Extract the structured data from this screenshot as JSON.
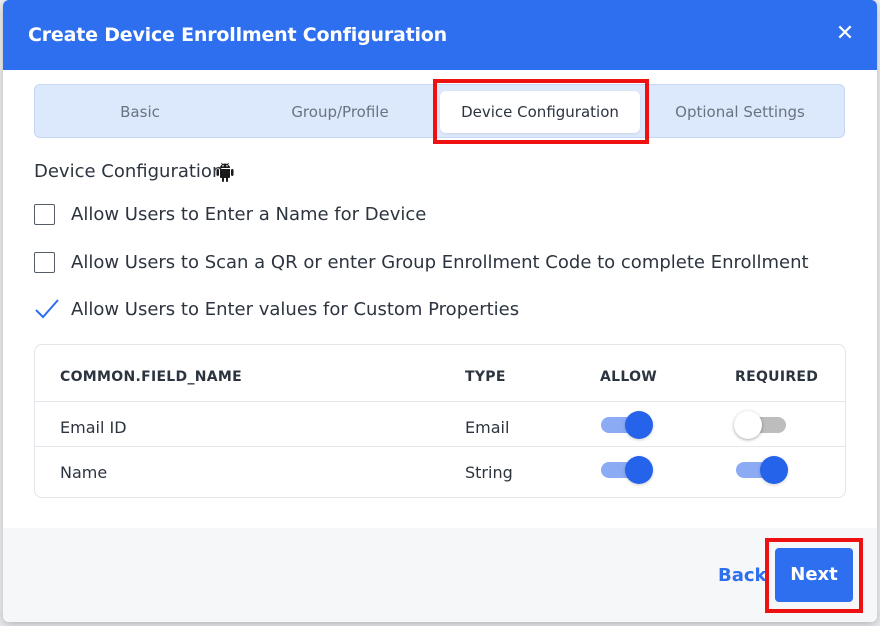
{
  "dialog": {
    "title": "Create Device Enrollment Configuration",
    "close_label": "✕"
  },
  "tabs": [
    {
      "label": "Basic",
      "active": false
    },
    {
      "label": "Group/Profile",
      "active": false
    },
    {
      "label": "Device Configuration",
      "active": true
    },
    {
      "label": "Optional Settings",
      "active": false
    }
  ],
  "section": {
    "title": "Device Configuration",
    "icon": "android-icon"
  },
  "options": [
    {
      "label": "Allow Users to Enter a Name for Device",
      "checked": false
    },
    {
      "label": "Allow Users to Scan a QR or enter Group Enrollment Code to complete Enrollment",
      "checked": false
    },
    {
      "label": "Allow Users to Enter values for Custom Properties",
      "checked": true
    }
  ],
  "table": {
    "headers": {
      "field": "COMMON.FIELD_NAME",
      "type": "TYPE",
      "allow": "ALLOW",
      "required": "REQUIRED"
    },
    "rows": [
      {
        "field": "Email ID",
        "type": "Email",
        "allow": true,
        "required": false
      },
      {
        "field": "Name",
        "type": "String",
        "allow": true,
        "required": true
      }
    ]
  },
  "footer": {
    "back_label": "Back",
    "next_label": "Next"
  },
  "colors": {
    "primary": "#2e6ff0",
    "highlight": "#ee1111",
    "toggle_on": "#2563eb"
  }
}
